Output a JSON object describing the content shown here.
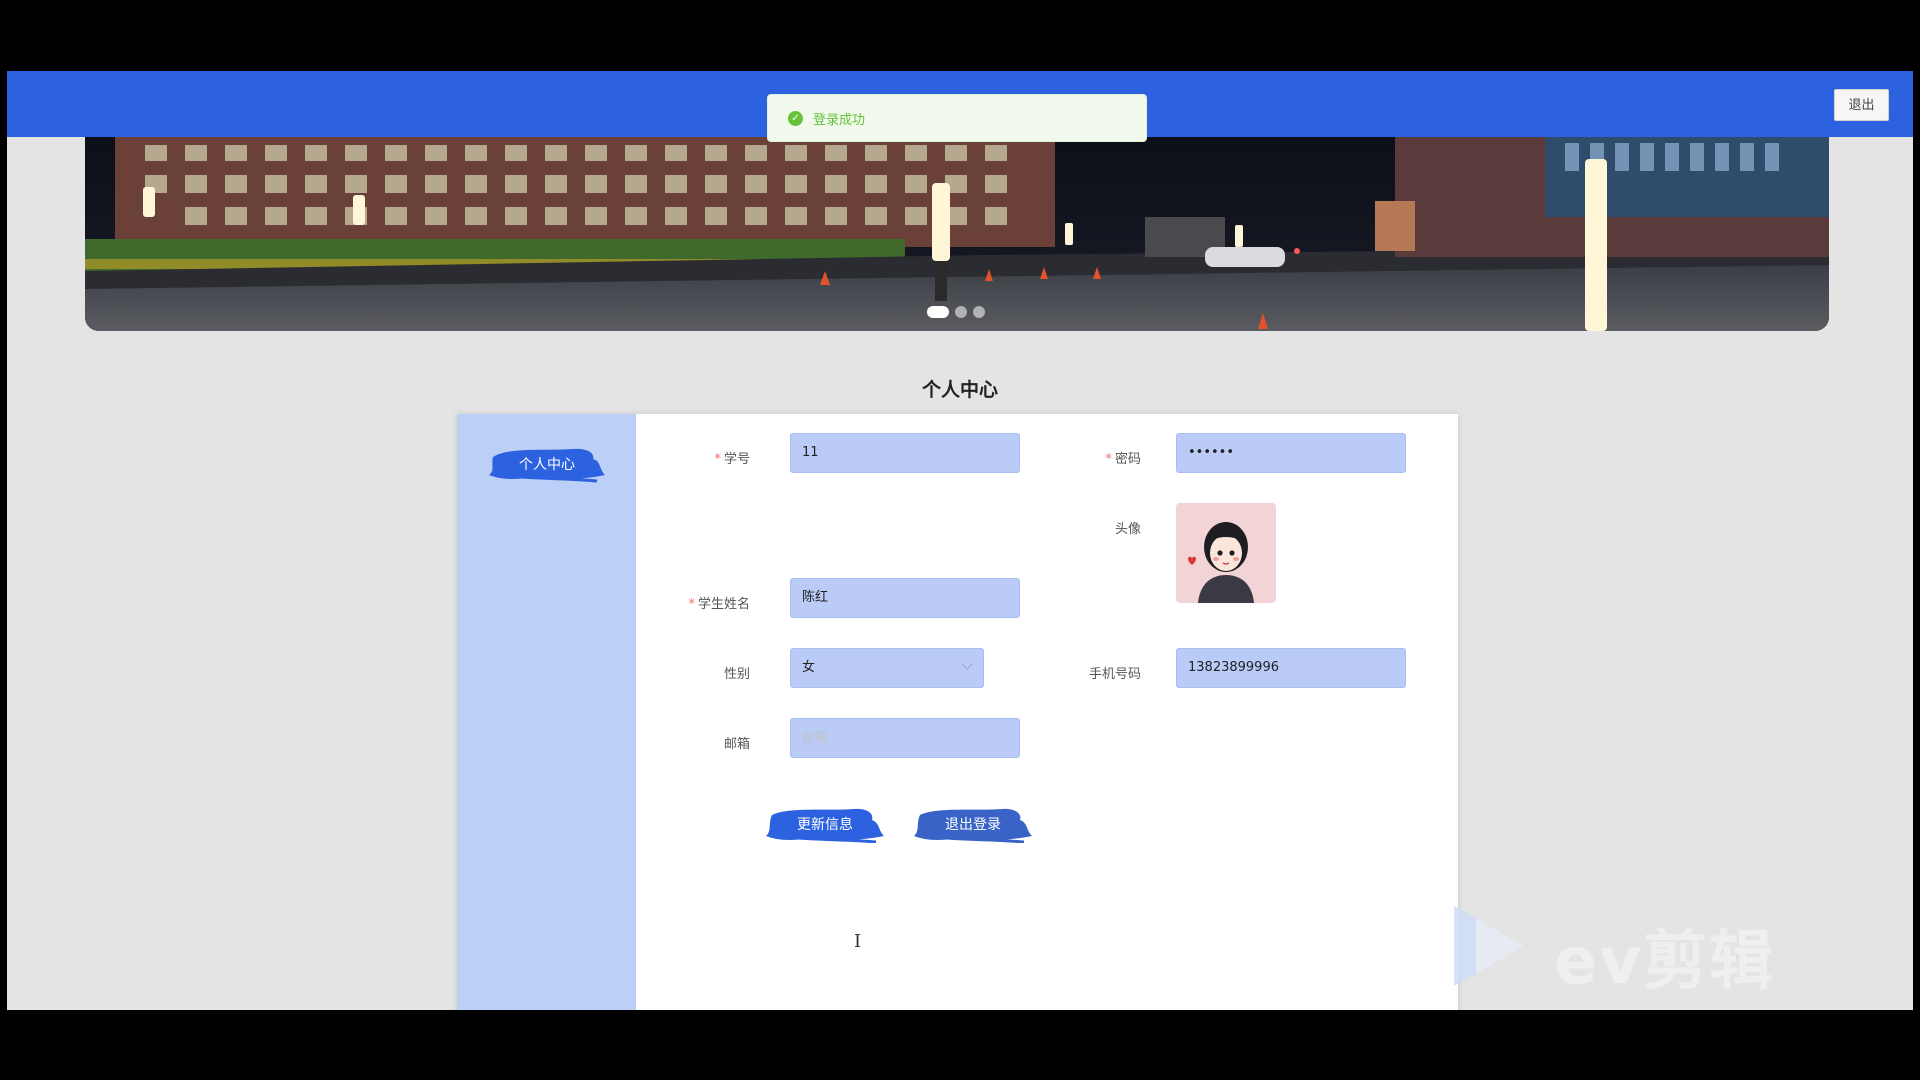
{
  "topbar": {
    "logout_label": "退出"
  },
  "toast": {
    "message": "登录成功"
  },
  "banner": {
    "slide_count": 3,
    "active_slide": 1
  },
  "page": {
    "title": "个人中心"
  },
  "sidebar": {
    "items": [
      {
        "label": "个人中心"
      }
    ]
  },
  "form": {
    "student_id": {
      "label": "学号",
      "value": "11",
      "required": true
    },
    "password": {
      "label": "密码",
      "value": "••••••",
      "required": true
    },
    "avatar": {
      "label": "头像"
    },
    "name": {
      "label": "学生姓名",
      "value": "陈红",
      "required": true
    },
    "gender": {
      "label": "性别",
      "value": "女"
    },
    "phone": {
      "label": "手机号码",
      "value": "13823899996"
    },
    "email": {
      "label": "邮箱",
      "value": "",
      "placeholder": "邮箱"
    }
  },
  "buttons": {
    "update_label": "更新信息",
    "logout_label": "退出登录"
  },
  "watermark": {
    "text": "ev剪辑"
  },
  "colors": {
    "primary": "#2c62e0",
    "sidebar": "#bccff7",
    "field": "#b9cbf6",
    "brush_dark": "#3a63c8",
    "success": "#67c23a"
  }
}
